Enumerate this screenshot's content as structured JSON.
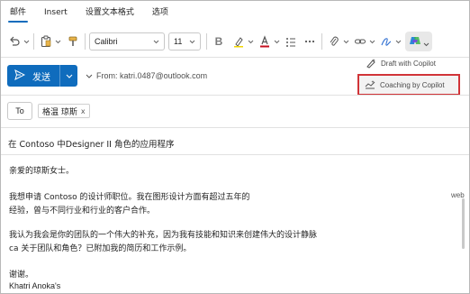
{
  "ribbon": {
    "tabs": [
      {
        "label": "邮件",
        "active": true
      },
      {
        "label": "Insert",
        "active": false
      },
      {
        "label": "设置文本格式",
        "active": false
      },
      {
        "label": "选项",
        "active": false
      }
    ]
  },
  "toolbar": {
    "font_name": "Calibri",
    "font_size": "11",
    "icons": [
      "undo-icon",
      "clipboard-icon",
      "format-painter-icon",
      "bold-icon",
      "highlighter-icon",
      "font-color-icon",
      "bullets-icon",
      "more-icon",
      "attach-icon",
      "link-icon",
      "signature-icon",
      "copilot-icon"
    ]
  },
  "copilot_menu": {
    "draft_label": "Draft with Copilot",
    "coaching_label": "Coaching by Copilot"
  },
  "compose": {
    "send_label": "发送",
    "from_label": "From: katri.0487@outlook.com",
    "to_label": "To",
    "recipient": "格温 琼斯",
    "recipient_remove": "x",
    "subject": "在 Contoso 中Designer II 角色的应用程序"
  },
  "body": {
    "greeting": "亲爱的琼斯女士。",
    "p1_line1": "我想申请 Contoso 的设计师职位。我在图形设计方面有超过五年的",
    "p1_line2": "经验，曾与不同行业和行业的客户合作。",
    "p2_line1": "我认为我会是你的团队的一个伟大的补充，因为我有技能和知识来创建伟大的设计静脉",
    "p2_line2": "ca 关于团队和角色？已附加我的简历和工作示例。",
    "closing": "谢谢。",
    "signature": "Khatri Anoka's",
    "side_note": "web"
  },
  "colors": {
    "accent": "#0f6cbd",
    "highlight_border": "#d13438"
  }
}
